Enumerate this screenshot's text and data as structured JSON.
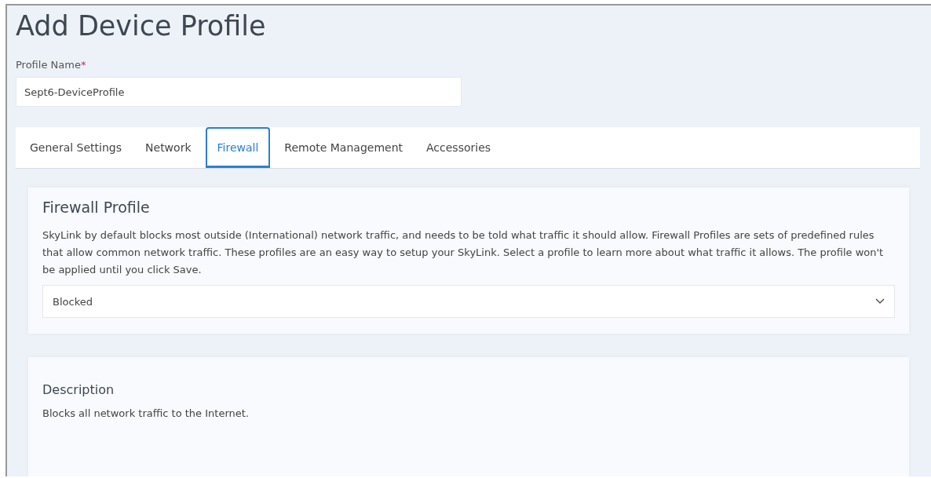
{
  "title": "Add Device Profile",
  "profile_name": {
    "label": "Profile Name",
    "required_mark": "*",
    "value": "Sept6-DeviceProfile"
  },
  "tabs": [
    {
      "label": "General Settings",
      "selected": false
    },
    {
      "label": "Network",
      "selected": false
    },
    {
      "label": "Firewall",
      "selected": true
    },
    {
      "label": "Remote Management",
      "selected": false
    },
    {
      "label": "Accessories",
      "selected": false
    }
  ],
  "firewall_profile": {
    "heading": "Firewall Profile",
    "text": "SkyLink by default blocks most outside (International) network traffic, and needs to be told what traffic it should allow. Firewall Profiles are sets of predefined rules that allow common network traffic. These profiles are an easy way to setup your SkyLink. Select a profile to learn more about what traffic it allows. The profile won't be applied until you click Save.",
    "select_value": "Blocked"
  },
  "description": {
    "heading": "Description",
    "text": "Blocks all network traffic to the Internet."
  }
}
